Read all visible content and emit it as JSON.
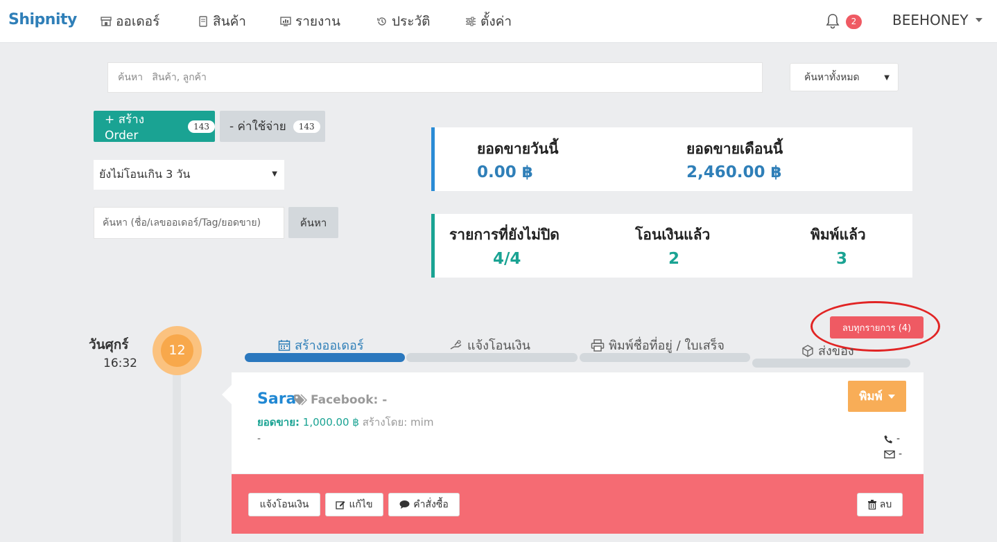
{
  "nav": {
    "brand": "Shipnity",
    "items": [
      {
        "label": "ออเดอร์",
        "icon": "store-icon"
      },
      {
        "label": "สินค้า",
        "icon": "products-icon"
      },
      {
        "label": "รายงาน",
        "icon": "report-icon"
      },
      {
        "label": "ประวัติ",
        "icon": "history-icon"
      },
      {
        "label": "ตั้งค่า",
        "icon": "settings-icon"
      }
    ],
    "notification_count": "2",
    "user": "BEEHONEY"
  },
  "search": {
    "placeholder": "ค้นหา   สินค้า, ลูกค้า",
    "scope": "ค้นหาทั้งหมด"
  },
  "actions": {
    "create_label": "+ สร้าง Order",
    "create_count": "143",
    "expense_label": "- ค่าใช้จ่าย",
    "expense_count": "143"
  },
  "filter": {
    "selected": "ยังไม่โอนเกิน 3 วัน",
    "order_search_placeholder": "ค้นหา (ชื่อ/เลขออเดอร์/Tag/ยอดขาย)",
    "search_button": "ค้นหา"
  },
  "stats": {
    "today_label": "ยอดขายวันนี้",
    "today_value": "0.00 ฿",
    "month_label": "ยอดขายเดือนนี้",
    "month_value": "2,460.00 ฿",
    "open_label": "รายการที่ยังไม่ปิด",
    "open_value": "4/4",
    "paid_label": "โอนเงินแล้ว",
    "paid_value": "2",
    "printed_label": "พิมพ์แล้ว",
    "printed_value": "3"
  },
  "clear_all": "ลบทุกรายการ (4)",
  "timeline": {
    "day": "วันศุกร์",
    "time": "16:32",
    "date": "12"
  },
  "steps": [
    {
      "label": "สร้างออเดอร์",
      "active": true
    },
    {
      "label": "แจ้งโอนเงิน",
      "active": false
    },
    {
      "label": "พิมพ์ชื่อที่อยู่ / ใบเสร็จ",
      "active": false
    },
    {
      "label": "ส่งของ",
      "active": false
    }
  ],
  "order": {
    "customer": "Sara",
    "channel": "Facebook: -",
    "sales_label": "ยอดขาย:",
    "sales_value": "1,000.00 ฿",
    "created_by": "สร้างโดย: mim",
    "note": "-",
    "phone": "-",
    "email": "-",
    "print_button": "พิมพ์"
  },
  "order_actions": {
    "notify_payment": "แจ้งโอนเงิน",
    "edit": "แก้ไข",
    "order_message": "คำสั่งซื้อ",
    "delete": "ลบ"
  },
  "colors": {
    "brand": "#2f7fb8",
    "teal": "#1aa393",
    "orange": "#f8a84b",
    "danger": "#ef5a63",
    "action_bar": "#f56b73"
  }
}
